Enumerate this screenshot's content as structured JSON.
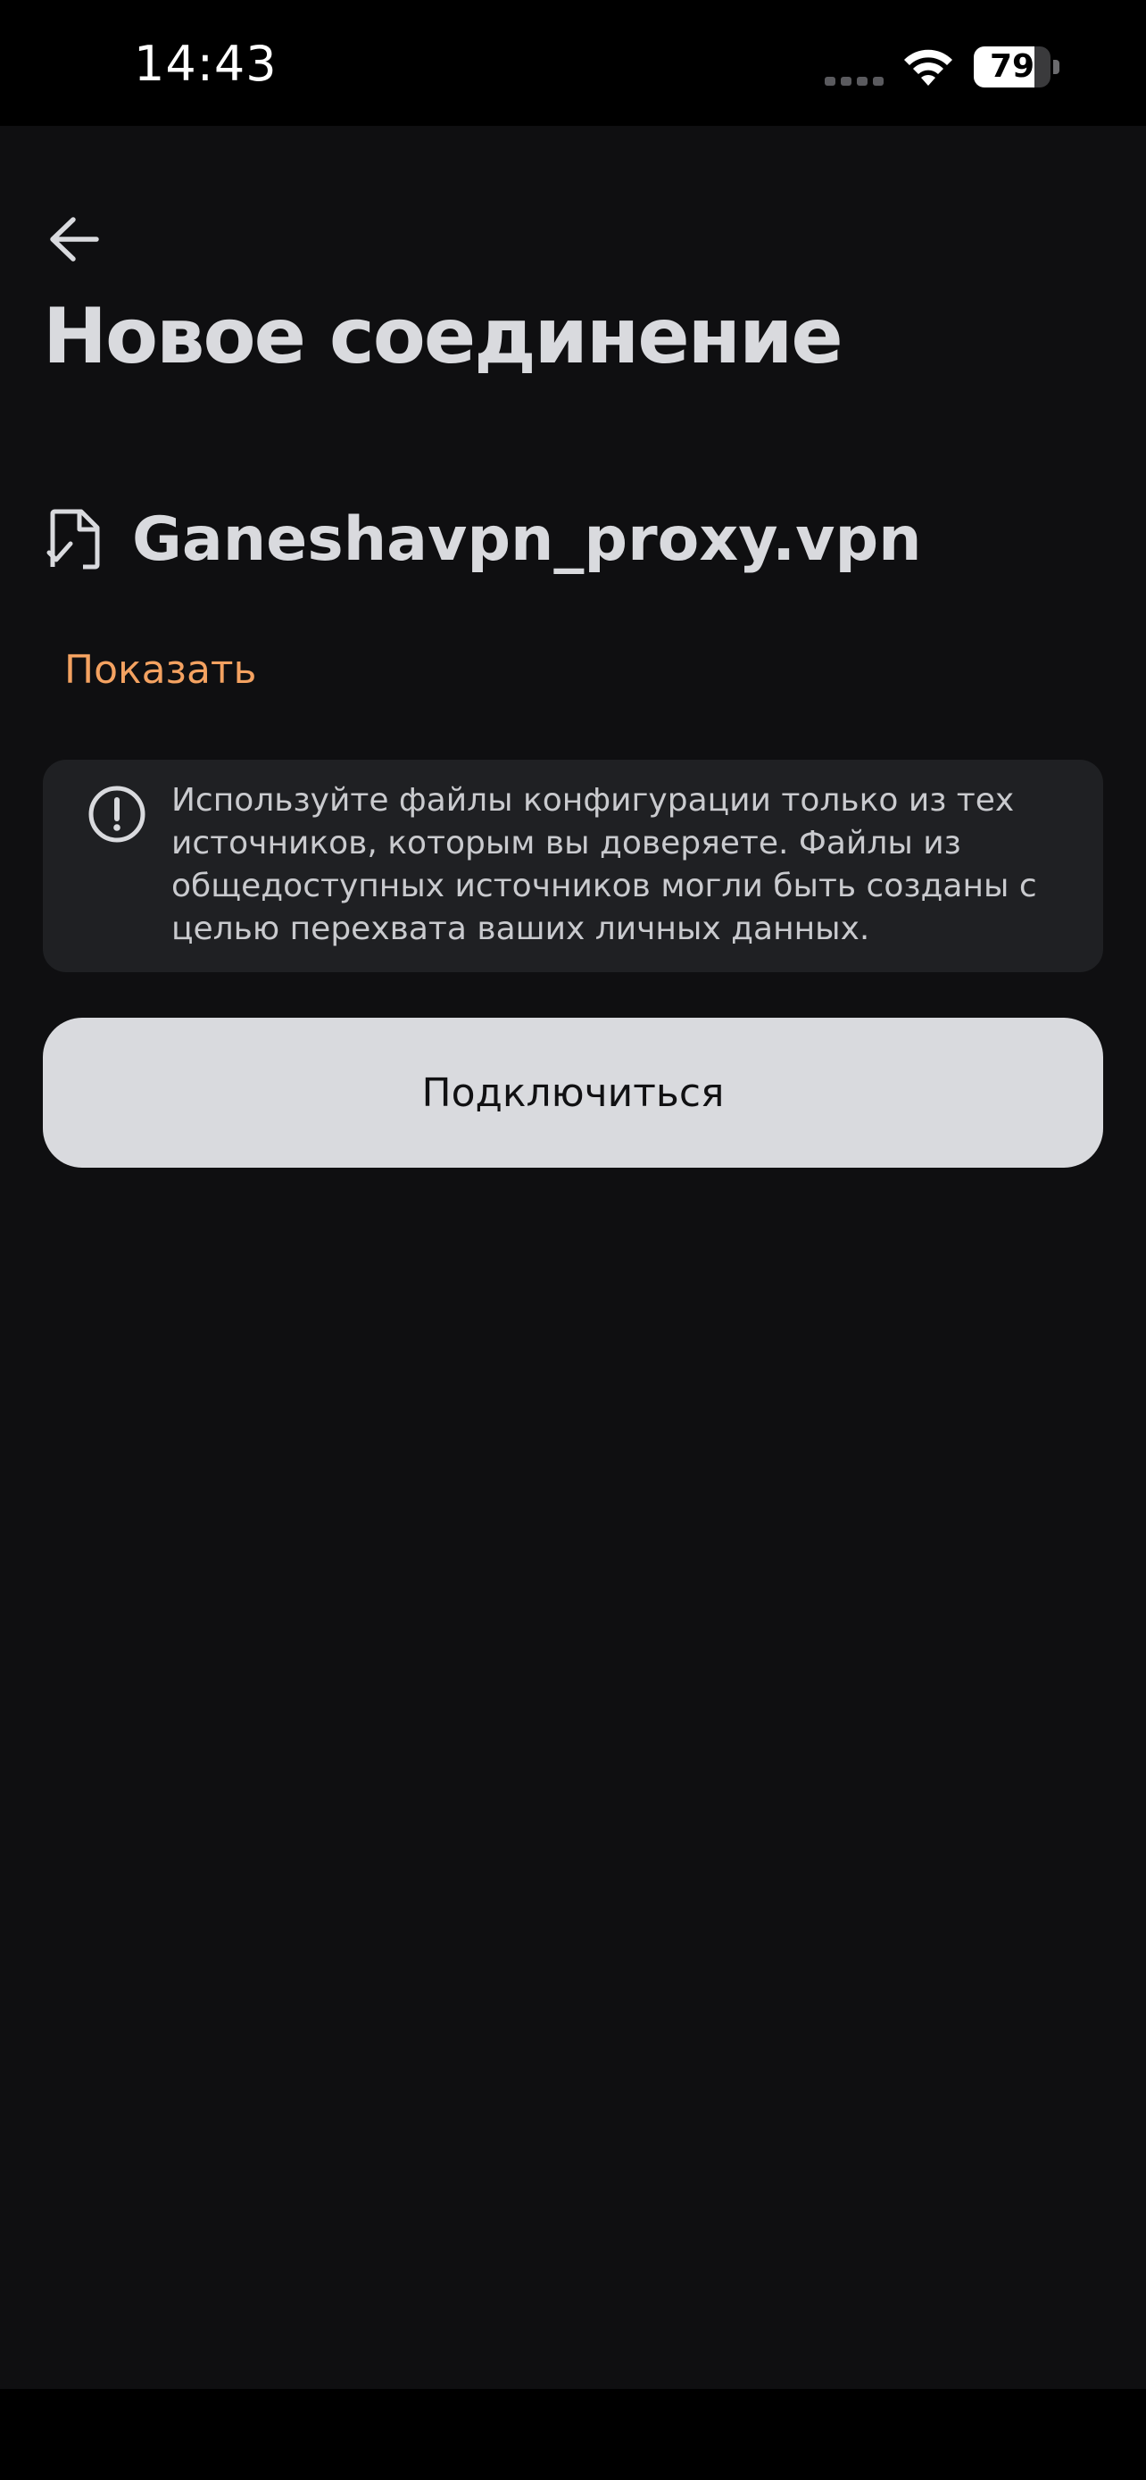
{
  "status_bar": {
    "time": "14:43",
    "battery_level": "79",
    "battery_fraction": 0.79,
    "icons": [
      "cellular-signal-icon",
      "wifi-icon",
      "battery-icon"
    ]
  },
  "header": {
    "back_icon": "arrow-left-icon",
    "title": "Новое соединение"
  },
  "file": {
    "icon": "file-check-icon",
    "name": "Ganeshavpn_proxy.vpn"
  },
  "show_link": "Показать",
  "warning": {
    "icon": "exclamation-circle-icon",
    "text": "Используйте файлы конфигурации только из тех источников, которым вы доверяете. Файлы из общедоступных источников могли быть созданы с целью перехвата ваших личных данных."
  },
  "connect_button": "Подключиться",
  "colors": {
    "background": "#0f0f11",
    "text": "#d9dade",
    "accent": "#f4a261",
    "card": "#1f2023",
    "button": "#d9dade"
  }
}
